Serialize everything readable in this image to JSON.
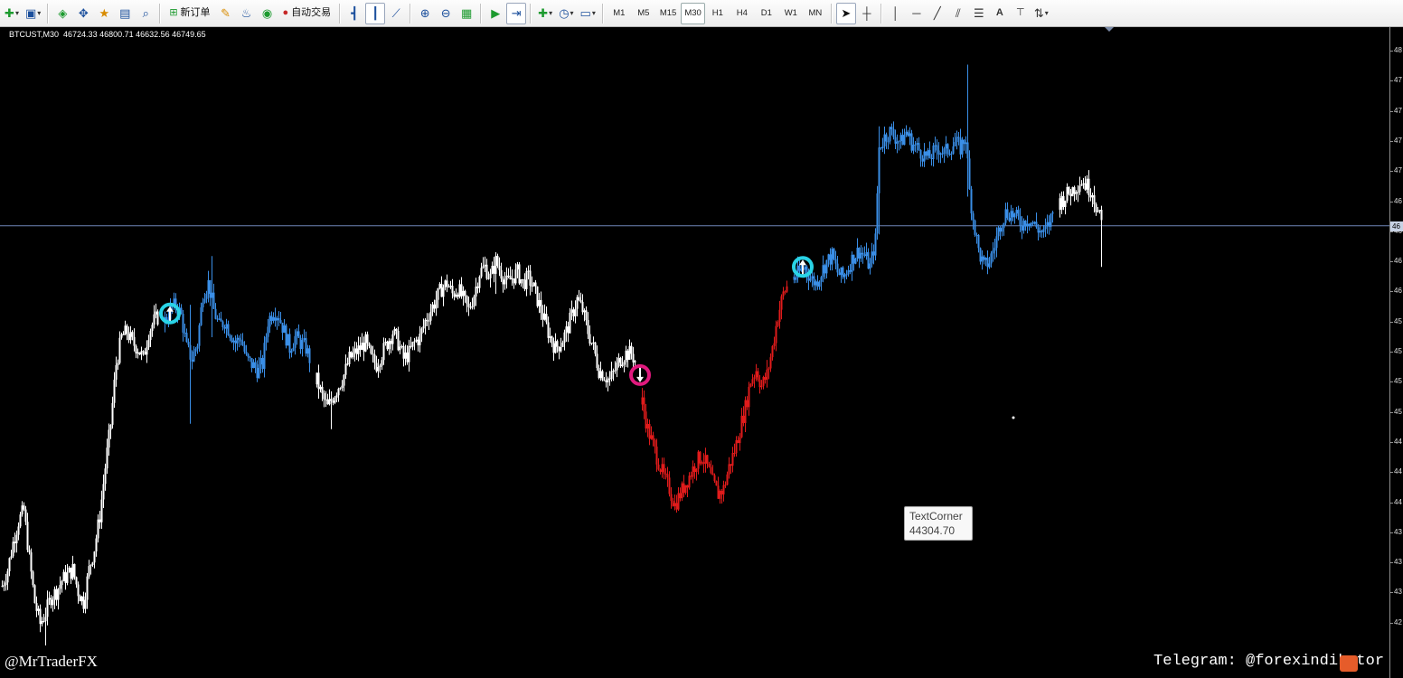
{
  "toolbar": {
    "new_order_label": "新订单",
    "auto_trading_label": "自动交易",
    "timeframes": [
      "M1",
      "M5",
      "M15",
      "M30",
      "H1",
      "H4",
      "D1",
      "W1",
      "MN"
    ],
    "active_timeframe": "M30"
  },
  "chart": {
    "symbol_header": "BTCUST,M30",
    "ohlc_header": "46724.33 46800.71 46632.56 46749.65",
    "background": "#000000",
    "colors": {
      "neutral": "#ffffff",
      "bull": "#3a8ee6",
      "bear": "#e01b1b",
      "signal_up": "#29d3e6",
      "signal_down": "#e0197d",
      "current_price_line": "#6f86b7"
    },
    "price_axis_labels": [
      "48",
      "47",
      "47",
      "47",
      "47",
      "46",
      "46",
      "46",
      "46",
      "45",
      "45",
      "45",
      "45",
      "44",
      "44",
      "44",
      "43",
      "43",
      "43",
      "42"
    ],
    "current_price_label": "46",
    "tooltip": {
      "title": "TextCorner",
      "value": "44304.70"
    },
    "signals": [
      {
        "kind": "up",
        "icon": "buy-arrow-icon"
      },
      {
        "kind": "down",
        "icon": "sell-arrow-icon"
      },
      {
        "kind": "up",
        "icon": "buy-arrow-icon"
      }
    ]
  },
  "watermarks": {
    "left": "@MrTraderFX",
    "right": "Telegram: @forexindikator"
  },
  "chart_data": {
    "type": "candlestick",
    "symbol": "BTCUST",
    "timeframe": "M30",
    "segments": [
      {
        "color": "neutral",
        "points": [
          [
            0,
            43000
          ],
          [
            6,
            43150
          ],
          [
            12,
            43400
          ],
          [
            18,
            43600
          ],
          [
            24,
            43700
          ],
          [
            30,
            43250
          ],
          [
            36,
            42850
          ],
          [
            42,
            42650
          ],
          [
            48,
            42750
          ],
          [
            54,
            42900
          ],
          [
            60,
            42950
          ],
          [
            66,
            43050
          ],
          [
            72,
            43100
          ],
          [
            78,
            43150
          ],
          [
            84,
            42950
          ],
          [
            90,
            42850
          ],
          [
            96,
            43150
          ],
          [
            102,
            43350
          ],
          [
            108,
            43650
          ],
          [
            114,
            44100
          ],
          [
            120,
            44500
          ],
          [
            126,
            45050
          ],
          [
            132,
            45300
          ],
          [
            138,
            45350
          ],
          [
            144,
            45250
          ],
          [
            150,
            45200
          ],
          [
            156,
            45100
          ],
          [
            162,
            45350
          ],
          [
            168,
            45450
          ],
          [
            174,
            45500
          ]
        ]
      },
      {
        "color": "bull",
        "points": [
          [
            180,
            45450
          ],
          [
            186,
            45550
          ],
          [
            192,
            45600
          ],
          [
            198,
            45500
          ],
          [
            204,
            45200
          ],
          [
            210,
            45100
          ],
          [
            216,
            45250
          ],
          [
            222,
            45700
          ],
          [
            228,
            45800
          ],
          [
            234,
            45550
          ],
          [
            240,
            45400
          ],
          [
            246,
            45450
          ],
          [
            252,
            45350
          ],
          [
            258,
            45250
          ],
          [
            264,
            45300
          ],
          [
            270,
            45100
          ],
          [
            276,
            45050
          ],
          [
            282,
            45000
          ],
          [
            288,
            45050
          ],
          [
            294,
            45450
          ],
          [
            300,
            45550
          ],
          [
            306,
            45500
          ],
          [
            312,
            45350
          ],
          [
            318,
            45200
          ],
          [
            324,
            45300
          ],
          [
            330,
            45250
          ],
          [
            336,
            45200
          ],
          [
            342,
            45050
          ]
        ]
      },
      {
        "color": "neutral",
        "points": [
          [
            348,
            44900
          ],
          [
            354,
            44750
          ],
          [
            360,
            44650
          ],
          [
            366,
            44750
          ],
          [
            372,
            44850
          ],
          [
            378,
            44950
          ],
          [
            384,
            45100
          ],
          [
            390,
            45150
          ],
          [
            396,
            45200
          ],
          [
            402,
            45250
          ],
          [
            408,
            45100
          ],
          [
            414,
            45050
          ],
          [
            420,
            45150
          ],
          [
            426,
            45250
          ],
          [
            432,
            45350
          ],
          [
            438,
            45250
          ],
          [
            444,
            45100
          ],
          [
            450,
            45150
          ],
          [
            456,
            45250
          ],
          [
            462,
            45300
          ],
          [
            468,
            45450
          ],
          [
            474,
            45550
          ],
          [
            480,
            45650
          ],
          [
            486,
            45750
          ],
          [
            492,
            45800
          ],
          [
            498,
            45700
          ],
          [
            504,
            45750
          ],
          [
            510,
            45650
          ],
          [
            516,
            45550
          ],
          [
            522,
            45700
          ],
          [
            528,
            45900
          ],
          [
            534,
            45950
          ],
          [
            540,
            45850
          ],
          [
            546,
            46000
          ],
          [
            552,
            45900
          ],
          [
            558,
            45800
          ],
          [
            564,
            45850
          ],
          [
            570,
            45900
          ],
          [
            576,
            45800
          ],
          [
            582,
            45850
          ],
          [
            588,
            45750
          ],
          [
            594,
            45600
          ],
          [
            600,
            45450
          ],
          [
            606,
            45300
          ],
          [
            612,
            45200
          ],
          [
            618,
            45250
          ],
          [
            624,
            45350
          ],
          [
            630,
            45500
          ],
          [
            636,
            45650
          ],
          [
            642,
            45550
          ],
          [
            648,
            45350
          ],
          [
            654,
            45200
          ],
          [
            660,
            45000
          ],
          [
            666,
            44950
          ],
          [
            672,
            44900
          ],
          [
            678,
            45000
          ],
          [
            684,
            45100
          ],
          [
            690,
            45150
          ],
          [
            696,
            45150
          ],
          [
            702,
            45050
          ]
        ]
      },
      {
        "color": "bear",
        "points": [
          [
            708,
            44700
          ],
          [
            714,
            44450
          ],
          [
            720,
            44300
          ],
          [
            726,
            44150
          ],
          [
            732,
            44000
          ],
          [
            738,
            43900
          ],
          [
            744,
            43750
          ],
          [
            750,
            43850
          ],
          [
            756,
            43950
          ],
          [
            762,
            44050
          ],
          [
            768,
            44150
          ],
          [
            774,
            44200
          ],
          [
            780,
            44100
          ],
          [
            786,
            43950
          ],
          [
            792,
            43850
          ],
          [
            798,
            43900
          ],
          [
            804,
            44100
          ],
          [
            810,
            44250
          ],
          [
            816,
            44450
          ],
          [
            822,
            44650
          ],
          [
            828,
            44900
          ],
          [
            834,
            45000
          ],
          [
            840,
            44850
          ],
          [
            846,
            44950
          ],
          [
            852,
            45200
          ],
          [
            858,
            45500
          ],
          [
            864,
            45700
          ],
          [
            870,
            45800
          ]
        ]
      },
      {
        "color": "bull",
        "points": [
          [
            876,
            45850
          ],
          [
            882,
            45900
          ],
          [
            888,
            45950
          ],
          [
            894,
            45850
          ],
          [
            900,
            45800
          ],
          [
            906,
            45900
          ],
          [
            912,
            46000
          ],
          [
            918,
            46050
          ],
          [
            924,
            45900
          ],
          [
            930,
            45850
          ],
          [
            936,
            45950
          ],
          [
            942,
            46050
          ],
          [
            948,
            46100
          ],
          [
            954,
            46050
          ],
          [
            960,
            45950
          ],
          [
            966,
            46200
          ],
          [
            970,
            47050
          ],
          [
            976,
            47150
          ],
          [
            982,
            47200
          ],
          [
            988,
            47150
          ],
          [
            994,
            47100
          ],
          [
            1000,
            47200
          ],
          [
            1006,
            47100
          ],
          [
            1012,
            47050
          ],
          [
            1018,
            47000
          ],
          [
            1024,
            46950
          ],
          [
            1030,
            47000
          ],
          [
            1036,
            47050
          ],
          [
            1042,
            47000
          ],
          [
            1048,
            47050
          ],
          [
            1054,
            47100
          ],
          [
            1060,
            47050
          ],
          [
            1066,
            47150
          ],
          [
            1070,
            46650
          ],
          [
            1074,
            46400
          ],
          [
            1080,
            46100
          ],
          [
            1086,
            45950
          ],
          [
            1092,
            46000
          ],
          [
            1098,
            46150
          ],
          [
            1104,
            46350
          ],
          [
            1110,
            46450
          ],
          [
            1116,
            46450
          ],
          [
            1122,
            46400
          ],
          [
            1128,
            46350
          ],
          [
            1134,
            46400
          ],
          [
            1140,
            46350
          ],
          [
            1146,
            46300
          ],
          [
            1152,
            46250
          ],
          [
            1158,
            46350
          ],
          [
            1164,
            46500
          ]
        ]
      },
      {
        "color": "neutral",
        "points": [
          [
            1170,
            46550
          ],
          [
            1176,
            46600
          ],
          [
            1182,
            46650
          ],
          [
            1188,
            46700
          ],
          [
            1194,
            46750
          ],
          [
            1200,
            46700
          ],
          [
            1206,
            46650
          ],
          [
            1212,
            46450
          ],
          [
            1218,
            46300
          ]
        ]
      }
    ],
    "signal_points": [
      {
        "kind": "buy",
        "bar": 186,
        "price": 45520
      },
      {
        "kind": "sell",
        "bar": 706,
        "price": 44950
      },
      {
        "kind": "buy",
        "bar": 886,
        "price": 45950
      }
    ],
    "current_price": 46330,
    "ylim": [
      42400,
      48000
    ]
  }
}
